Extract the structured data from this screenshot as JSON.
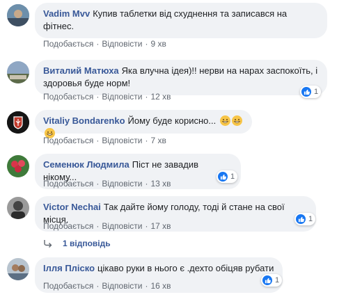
{
  "comments": [
    {
      "author": "Vadim Mvv",
      "text": "Купив таблетки від схуднення та записався на фітнес.",
      "like_label": "Подобається",
      "reply_label": "Відповісти",
      "time": "9 хв"
    },
    {
      "author": "Виталий Матюха",
      "text": "Яка влучна ідея)!! нерви на нарах заспокоїть, і здоровья буде норм!",
      "like_label": "Подобається",
      "reply_label": "Відповісти",
      "time": "12 хв",
      "reactions": "1"
    },
    {
      "author": "Vitaliy Bondarenko",
      "text": "Йому буде корисно...",
      "like_label": "Подобається",
      "reply_label": "Відповісти",
      "time": "7 хв"
    },
    {
      "author": "Семенюк Людмила",
      "text": "Піст не завадив нікому...",
      "like_label": "Подобається",
      "reply_label": "Відповісти",
      "time": "13 хв",
      "reactions": "1"
    },
    {
      "author": "Victor Nechai",
      "text": "Так дайте йому голоду, тоді й стане на свої місця.",
      "like_label": "Подобається",
      "reply_label": "Відповісти",
      "time": "17 хв",
      "reactions": "1"
    },
    {
      "author": "Ілля Пліско",
      "text": "цікаво руки в нього є .дехто обіцяв рубати .",
      "like_label": "Подобається",
      "reply_label": "Відповісти",
      "time": "16 хв",
      "reactions": "1"
    }
  ],
  "replies_link": "1 відповідь",
  "dot_separator": "·",
  "icons": {
    "like": "thumbs-up-icon",
    "emoji": "grinning-face-icon",
    "reply_arrow": "reply-arrow-icon"
  },
  "colors": {
    "author": "#385898",
    "bubble": "#f0f2f5",
    "like_blue": "#1877f2"
  }
}
